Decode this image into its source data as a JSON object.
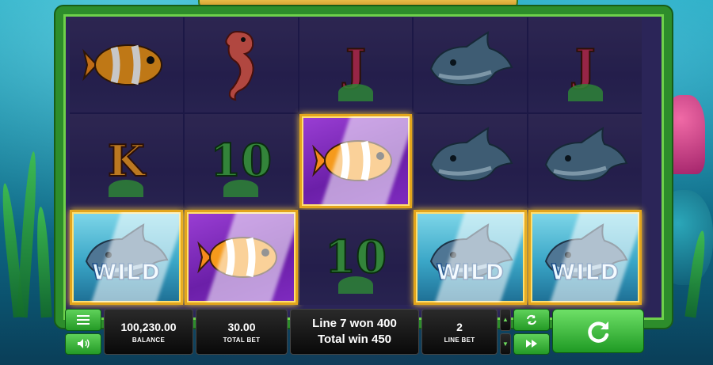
{
  "reels": [
    [
      {
        "symbol": "clownfish",
        "style": "dim"
      },
      {
        "symbol": "letter",
        "text": "K",
        "style": "dim"
      },
      {
        "symbol": "wild",
        "text": "WILD",
        "style": "wild"
      }
    ],
    [
      {
        "symbol": "seahorse",
        "style": "dim"
      },
      {
        "symbol": "letter",
        "text": "10",
        "style": "dim"
      },
      {
        "symbol": "clownfish",
        "style": "win"
      }
    ],
    [
      {
        "symbol": "letter",
        "text": "J",
        "style": "dim"
      },
      {
        "symbol": "clownfish",
        "style": "win"
      },
      {
        "symbol": "letter",
        "text": "10",
        "style": "dim"
      }
    ],
    [
      {
        "symbol": "dolphin",
        "style": "dim"
      },
      {
        "symbol": "dolphin",
        "style": "dim"
      },
      {
        "symbol": "wild",
        "text": "WILD",
        "style": "wild"
      }
    ],
    [
      {
        "symbol": "letter",
        "text": "J",
        "style": "dim"
      },
      {
        "symbol": "dolphin",
        "style": "dim"
      },
      {
        "symbol": "wild",
        "text": "WILD",
        "style": "wild"
      }
    ]
  ],
  "controls": {
    "balance_value": "100,230.00",
    "balance_label": "BALANCE",
    "total_bet_value": "30.00",
    "total_bet_label": "TOTAL BET",
    "win_line": "Line 7 won 400",
    "total_win": "Total win 450",
    "line_bet_value": "2",
    "line_bet_label": "LINE BET"
  },
  "icons": {
    "menu": "menu-icon",
    "sound": "speaker-icon",
    "autoplay": "autoplay-icon",
    "turbo": "fast-forward-icon",
    "spin": "spin-icon",
    "bet_up": "arrow-up-icon",
    "bet_down": "arrow-down-icon"
  },
  "colors": {
    "frame": "#2d8d2b",
    "button_green": "#249a26",
    "win_border": "#e3a51c",
    "panel": "#0c0c0c"
  }
}
